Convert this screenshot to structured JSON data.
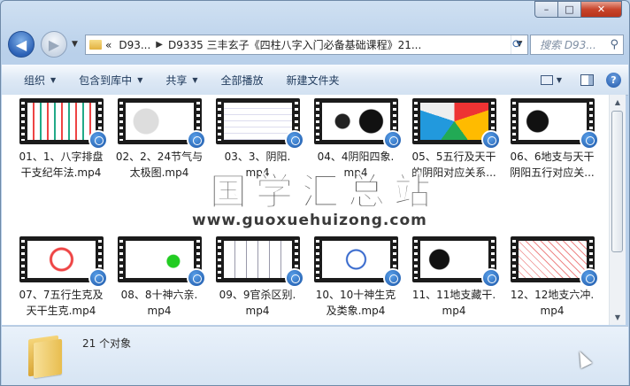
{
  "window": {
    "controls": {
      "minimize": "–",
      "maximize": "□",
      "close": "✕"
    }
  },
  "nav": {
    "back_icon": "arrow-left-icon",
    "forward_icon": "arrow-right-icon",
    "address": {
      "prefix": "«",
      "crumbs": [
        "D93...",
        "D9335 三丰玄子《四柱八字入门必备基础课程》21..."
      ]
    },
    "search_placeholder": "搜索 D93..."
  },
  "toolbar": {
    "organize": "组织",
    "include_in_library": "包含到库中",
    "share": "共享",
    "slideshow": "全部播放",
    "new_folder": "新建文件夹",
    "help": "?"
  },
  "files": [
    {
      "name": "01、1、八字排盘干支纪年法.mp4",
      "line1": "01、1、八字排盘",
      "line2": "干支纪年法.mp4"
    },
    {
      "name": "02、2、24节气与太极图.mp4",
      "line1": "02、2、24节气与",
      "line2": "太极图.mp4"
    },
    {
      "name": "03、3、阴阳.mp4",
      "line1": "03、3、阴阳.",
      "line2": "mp4"
    },
    {
      "name": "04、4阴阳四象.mp4",
      "line1": "04、4阴阳四象.",
      "line2": "mp4"
    },
    {
      "name": "05、5五行及天干的阴阳对应关系...",
      "line1": "05、5五行及天干",
      "line2": "的阴阳对应关系..."
    },
    {
      "name": "06、6地支与天干阴阳五行对应关...",
      "line1": "06、6地支与天干",
      "line2": "阴阳五行对应关..."
    },
    {
      "name": "07、7五行生克及天干生克.mp4",
      "line1": "07、7五行生克及",
      "line2": "天干生克.mp4"
    },
    {
      "name": "08、8十神六亲.mp4",
      "line1": "08、8十神六亲.",
      "line2": "mp4"
    },
    {
      "name": "09、9官杀区别.mp4",
      "line1": "09、9官杀区别.",
      "line2": "mp4"
    },
    {
      "name": "10、10十神生克及类象.mp4",
      "line1": "10、10十神生克",
      "line2": "及类象.mp4"
    },
    {
      "name": "11、11地支藏干.mp4",
      "line1": "11、11地支藏干.",
      "line2": "mp4"
    },
    {
      "name": "12、12地支六冲.mp4",
      "line1": "12、12地支六冲.",
      "line2": "mp4"
    }
  ],
  "watermark": {
    "title": "国学汇总站",
    "url": "www.guoxuehuizong.com"
  },
  "details": {
    "count": "21 个对象"
  }
}
